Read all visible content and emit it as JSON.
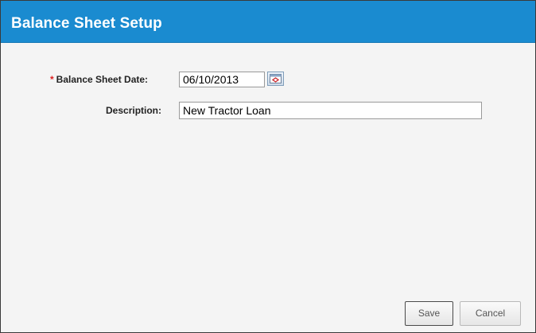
{
  "dialog": {
    "title": "Balance Sheet Setup"
  },
  "form": {
    "required_marker": "*",
    "balance_sheet_date": {
      "label": "Balance Sheet Date:",
      "value": "06/10/2013"
    },
    "description": {
      "label": "Description:",
      "value": "New Tractor Loan"
    }
  },
  "buttons": {
    "save_label": "Save",
    "cancel_label": "Cancel"
  },
  "colors": {
    "title_bar": "#1a8bd0",
    "required_star": "#dd2222"
  },
  "icons": {
    "date_picker": "calendar-icon"
  }
}
